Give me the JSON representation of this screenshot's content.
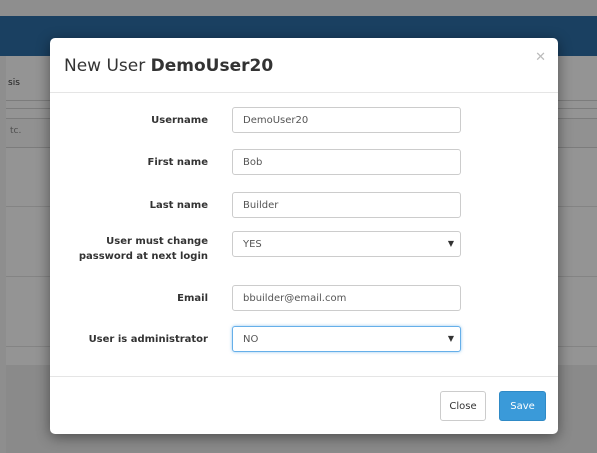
{
  "background": {
    "tab_fragment": "sis",
    "filter_fragment": "tc."
  },
  "modal": {
    "title_prefix": "New User",
    "title_username": "DemoUser20",
    "close_icon": "close-icon",
    "fields": {
      "username": {
        "label": "Username",
        "value": "DemoUser20"
      },
      "first_name": {
        "label": "First name",
        "value": "Bob"
      },
      "last_name": {
        "label": "Last name",
        "value": "Builder"
      },
      "must_change_password": {
        "label_line1": "User must change",
        "label_line2": "password at next login",
        "value": "YES"
      },
      "email": {
        "label": "Email",
        "value": "bbuilder@email.com"
      },
      "is_admin": {
        "label": "User is administrator",
        "value": "NO"
      }
    },
    "buttons": {
      "close": "Close",
      "save": "Save"
    },
    "colors": {
      "header_bar": "#2d6ea8",
      "primary_button": "#3a9ad9",
      "focus_border": "#66afe9"
    }
  }
}
